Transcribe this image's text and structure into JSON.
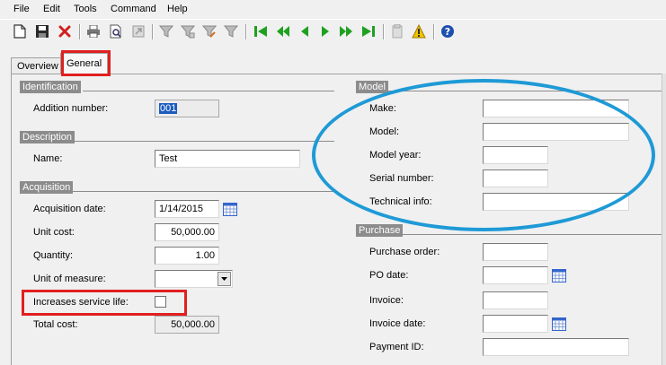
{
  "menu": [
    "File",
    "Edit",
    "Tools",
    "Command",
    "Help"
  ],
  "toolbar": {
    "icons": [
      "new-document-icon",
      "save-icon",
      "delete-icon",
      "print-icon",
      "print-preview-icon",
      "export-icon",
      "filter-icon",
      "filter-by-selection-icon",
      "advanced-filter-icon",
      "remove-filter-icon",
      "first-record-icon",
      "previous-page-icon",
      "previous-record-icon",
      "next-record-icon",
      "next-page-icon",
      "last-record-icon",
      "attachments-icon",
      "alert-icon",
      "help-icon"
    ]
  },
  "tabs": {
    "overview": "Overview",
    "general": "General"
  },
  "identification": {
    "header": "Identification",
    "addition_number_label": "Addition number:",
    "addition_number_value": "001"
  },
  "description": {
    "header": "Description",
    "name_label": "Name:",
    "name_value": "Test"
  },
  "acquisition": {
    "header": "Acquisition",
    "acquisition_date_label": "Acquisition date:",
    "acquisition_date_value": "1/14/2015",
    "unit_cost_label": "Unit cost:",
    "unit_cost_value": "50,000.00",
    "quantity_label": "Quantity:",
    "quantity_value": "1.00",
    "unit_of_measure_label": "Unit of measure:",
    "unit_of_measure_value": "",
    "increases_service_life_label": "Increases service life:",
    "increases_service_life_checked": false,
    "total_cost_label": "Total cost:",
    "total_cost_value": "50,000.00"
  },
  "model": {
    "header": "Model",
    "make_label": "Make:",
    "make_value": "",
    "model_label": "Model:",
    "model_value": "",
    "model_year_label": "Model year:",
    "model_year_value": "",
    "serial_number_label": "Serial number:",
    "serial_number_value": "",
    "technical_info_label": "Technical info:",
    "technical_info_value": ""
  },
  "purchase": {
    "header": "Purchase",
    "purchase_order_label": "Purchase order:",
    "purchase_order_value": "",
    "po_date_label": "PO date:",
    "po_date_value": "",
    "invoice_label": "Invoice:",
    "invoice_value": "",
    "invoice_date_label": "Invoice date:",
    "invoice_date_value": "",
    "payment_id_label": "Payment ID:",
    "payment_id_value": ""
  },
  "colors": {
    "group_header_bg": "#8c8c8c",
    "annotation_red": "#e0201f",
    "annotation_blue": "#1e9ad6",
    "selection_blue": "#1b5cbd"
  }
}
